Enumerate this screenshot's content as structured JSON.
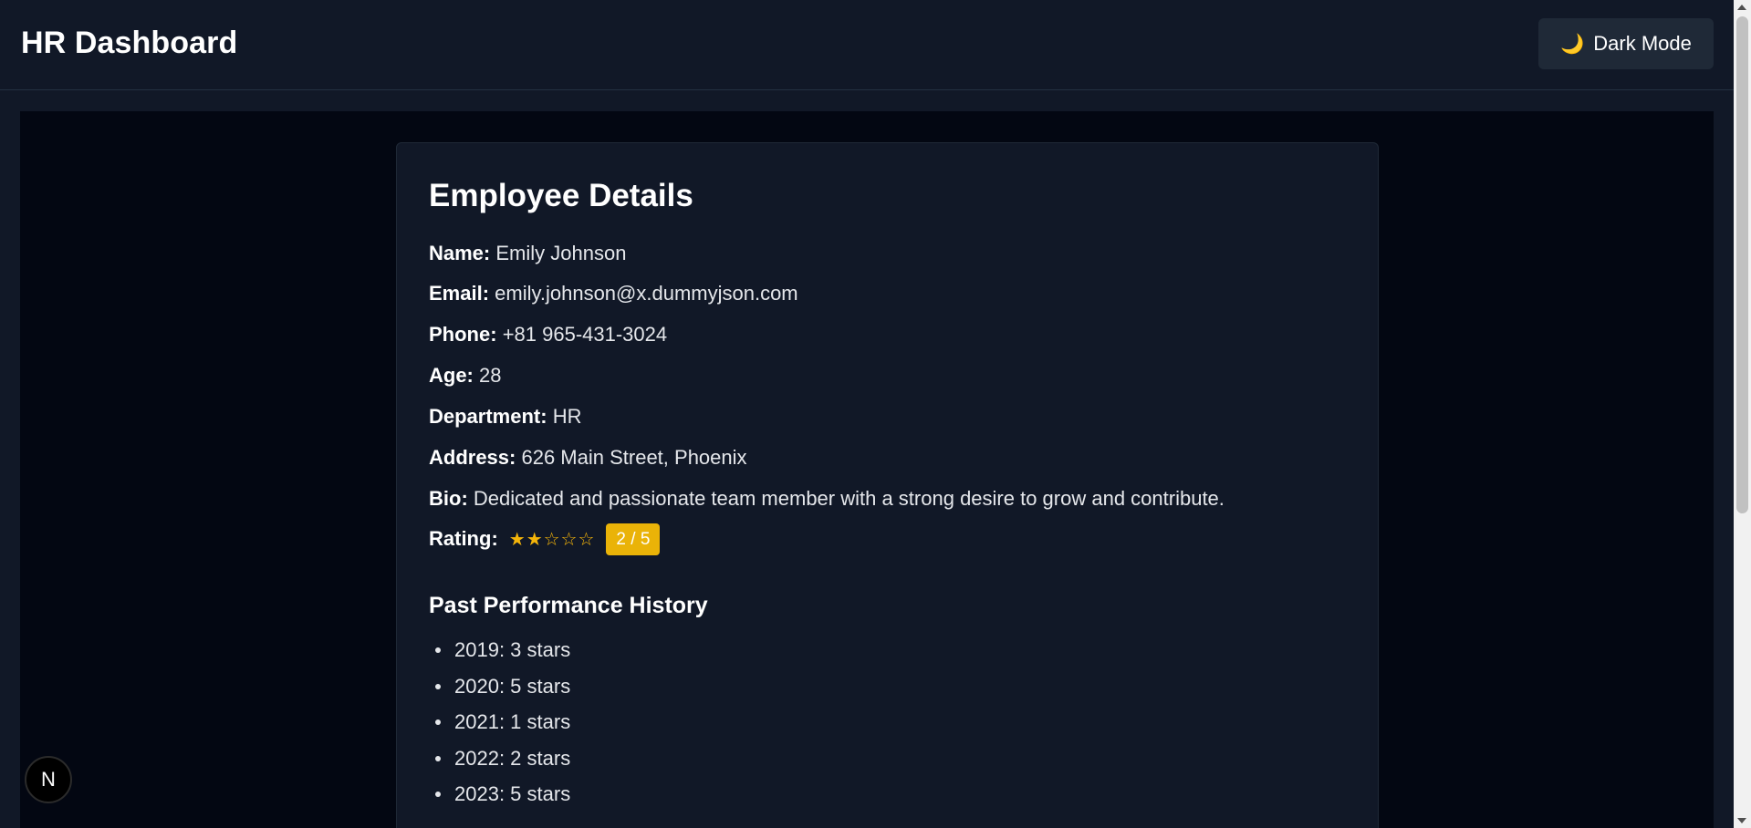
{
  "header": {
    "title": "HR Dashboard",
    "theme_toggle": {
      "icon": "moon-icon",
      "icon_glyph": "🌙",
      "label": "Dark Mode"
    }
  },
  "employee": {
    "section_title": "Employee Details",
    "fields": [
      {
        "label": "Name:",
        "value": "Emily Johnson"
      },
      {
        "label": "Email:",
        "value": "emily.johnson@x.dummyjson.com"
      },
      {
        "label": "Phone:",
        "value": "+81 965-431-3024"
      },
      {
        "label": "Age:",
        "value": "28"
      },
      {
        "label": "Department:",
        "value": "HR"
      },
      {
        "label": "Address:",
        "value": "626 Main Street, Phoenix"
      },
      {
        "label": "Bio:",
        "value": "Dedicated and passionate team member with a strong desire to grow and contribute."
      }
    ],
    "rating": {
      "label": "Rating:",
      "stars": "★★☆☆☆",
      "value": 2,
      "max": 5,
      "badge_text": "2 / 5"
    }
  },
  "performance": {
    "title": "Past Performance History",
    "items": [
      "2019: 3 stars",
      "2020: 5 stars",
      "2021: 1 stars",
      "2022: 2 stars",
      "2023: 5 stars"
    ]
  },
  "floating_button": {
    "label": "N"
  },
  "colors": {
    "header_bg": "#111827",
    "main_bg": "#030712",
    "card_bg": "#111827",
    "button_bg": "#1f2937",
    "star_color": "#f5b50a",
    "badge_bg": "#eab308"
  }
}
